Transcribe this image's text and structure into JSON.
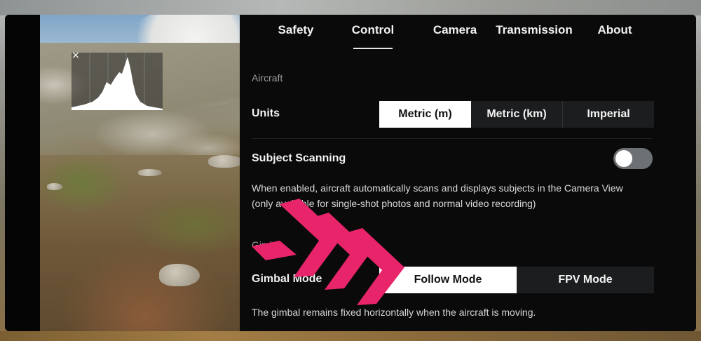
{
  "tabs": [
    {
      "label": "Safety",
      "active": false
    },
    {
      "label": "Control",
      "active": true
    },
    {
      "label": "Camera",
      "active": false
    },
    {
      "label": "Transmission",
      "active": false
    },
    {
      "label": "About",
      "active": false
    }
  ],
  "aircraft_section": {
    "title": "Aircraft",
    "units": {
      "label": "Units",
      "options": [
        "Metric (m)",
        "Metric (km)",
        "Imperial"
      ],
      "selected": "Metric (m)"
    },
    "subject_scanning": {
      "label": "Subject Scanning",
      "enabled": false,
      "description_line1": "When enabled, aircraft automatically scans and displays subjects in the Camera View",
      "description_line2": "(only available for single-shot photos and normal video recording)"
    }
  },
  "gimbal_section": {
    "title": "Gimb",
    "gimbal_mode": {
      "label": "Gimbal Mode",
      "options": [
        "Follow Mode",
        "FPV Mode"
      ],
      "selected": "Follow Mode",
      "description": "The gimbal remains fixed horizontally when the aircraft is moving."
    }
  },
  "camera_view": {
    "histogram_close_icon": "×"
  },
  "colors": {
    "panel_bg": "#0a0a0a",
    "segment_bg": "#1c1d1e",
    "segment_active": "#ffffff",
    "annotation_arrow": "#e8246b"
  }
}
